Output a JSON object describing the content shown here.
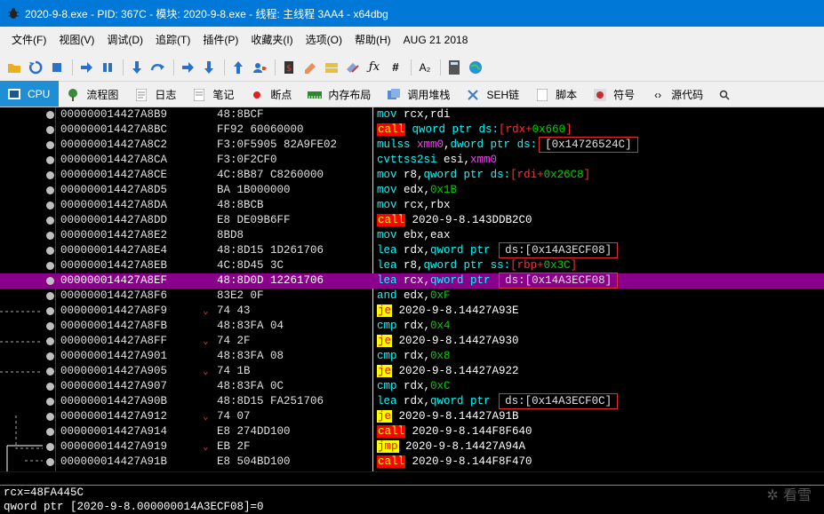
{
  "window": {
    "title": "2020-9-8.exe - PID: 367C - 模块: 2020-9-8.exe - 线程: 主线程 3AA4 - x64dbg",
    "icon": "bug-icon"
  },
  "menu": [
    "文件(F)",
    "视图(V)",
    "调试(D)",
    "追踪(T)",
    "插件(P)",
    "收藏夹(I)",
    "选项(O)",
    "帮助(H)",
    "AUG 21 2018"
  ],
  "toolbar_icons": [
    "open-icon",
    "restart-icon",
    "stop-icon",
    "run-icon",
    "pause-icon",
    "step-into-icon",
    "step-over-icon",
    "trace-into-icon",
    "trace-over-icon",
    "execute-till-return-icon",
    "run-to-user-code-icon",
    "patch-icon",
    "comment-icon",
    "label-icon",
    "bookmark-icon",
    "function-icon",
    "hash-icon",
    "font-icon",
    "calculator-icon",
    "globe-icon"
  ],
  "tabs": [
    {
      "label": "CPU",
      "icon": "cpu-icon",
      "active": true
    },
    {
      "label": "流程图",
      "icon": "graph-icon"
    },
    {
      "label": "日志",
      "icon": "log-icon"
    },
    {
      "label": "笔记",
      "icon": "notes-icon"
    },
    {
      "label": "断点",
      "icon": "breakpoint-icon"
    },
    {
      "label": "内存布局",
      "icon": "memory-icon"
    },
    {
      "label": "调用堆栈",
      "icon": "callstack-icon"
    },
    {
      "label": "SEH链",
      "icon": "seh-icon"
    },
    {
      "label": "脚本",
      "icon": "script-icon"
    },
    {
      "label": "符号",
      "icon": "symbols-icon"
    },
    {
      "label": "源代码",
      "icon": "source-icon"
    }
  ],
  "rows": [
    {
      "addr": "000000014427A8B9",
      "bytes": "48:8BCF",
      "jmark": "",
      "instr": [
        [
          "mov",
          "m-mnem"
        ],
        [
          " rcx",
          "m-white"
        ],
        [
          ",",
          "m-white"
        ],
        [
          "rdi",
          "m-white"
        ]
      ]
    },
    {
      "addr": "000000014427A8BC",
      "bytes": "FF92 60060000",
      "jmark": "",
      "instr": [
        [
          "call",
          "hl-call"
        ],
        [
          " qword ptr ",
          "m-mnem"
        ],
        [
          "ds:",
          "m-mnem"
        ],
        [
          "[",
          "m-red"
        ],
        [
          "rdx",
          "m-red"
        ],
        [
          "+",
          "m-red"
        ],
        [
          "0x660",
          "m-num"
        ],
        [
          "]",
          "m-red"
        ]
      ]
    },
    {
      "addr": "000000014427A8C2",
      "bytes": "F3:0F5905 82A9FE02",
      "jmark": "",
      "instr": [
        [
          "mulss",
          "m-mnem"
        ],
        [
          " xmm0",
          "m-mag"
        ],
        [
          ",",
          "m-white"
        ],
        [
          "dword ptr ",
          "m-mnem"
        ],
        [
          "ds:",
          "m-mnem"
        ],
        [
          "[0x14726524C]",
          "box"
        ]
      ]
    },
    {
      "addr": "000000014427A8CA",
      "bytes": "F3:0F2CF0",
      "jmark": "",
      "instr": [
        [
          "cvttss2si",
          "m-mnem"
        ],
        [
          " esi",
          "m-white"
        ],
        [
          ",",
          "m-white"
        ],
        [
          "xmm0",
          "m-mag"
        ]
      ]
    },
    {
      "addr": "000000014427A8CE",
      "bytes": "4C:8B87 C8260000",
      "jmark": "",
      "instr": [
        [
          "mov",
          "m-mnem"
        ],
        [
          " r8",
          "m-white"
        ],
        [
          ",",
          "m-white"
        ],
        [
          "qword ptr ",
          "m-mnem"
        ],
        [
          "ds:",
          "m-mnem"
        ],
        [
          "[",
          "m-red"
        ],
        [
          "rdi",
          "m-red"
        ],
        [
          "+",
          "m-red"
        ],
        [
          "0x26C8",
          "m-num"
        ],
        [
          "]",
          "m-red"
        ]
      ]
    },
    {
      "addr": "000000014427A8D5",
      "bytes": "BA 1B000000",
      "jmark": "",
      "instr": [
        [
          "mov",
          "m-mnem"
        ],
        [
          " edx",
          "m-white"
        ],
        [
          ",",
          "m-white"
        ],
        [
          "0x1B",
          "m-num"
        ]
      ]
    },
    {
      "addr": "000000014427A8DA",
      "bytes": "48:8BCB",
      "jmark": "",
      "instr": [
        [
          "mov",
          "m-mnem"
        ],
        [
          " rcx",
          "m-white"
        ],
        [
          ",",
          "m-white"
        ],
        [
          "rbx",
          "m-white"
        ]
      ]
    },
    {
      "addr": "000000014427A8DD",
      "bytes": "E8 DE09B6FF",
      "jmark": "",
      "instr": [
        [
          "call",
          "hl-call"
        ],
        [
          " 2020-9-8.143DDB2C0",
          "m-white"
        ]
      ]
    },
    {
      "addr": "000000014427A8E2",
      "bytes": "8BD8",
      "jmark": "",
      "instr": [
        [
          "mov",
          "m-mnem"
        ],
        [
          " ebx",
          "m-white"
        ],
        [
          ",",
          "m-white"
        ],
        [
          "eax",
          "m-white"
        ]
      ]
    },
    {
      "addr": "000000014427A8E4",
      "bytes": "48:8D15 1D261706",
      "jmark": "",
      "instr": [
        [
          "lea",
          "m-mnem"
        ],
        [
          " rdx",
          "m-white"
        ],
        [
          ",",
          "m-white"
        ],
        [
          "qword ptr ",
          "m-mnem"
        ],
        [
          "ds:[0x14A3ECF08]",
          "box"
        ]
      ]
    },
    {
      "addr": "000000014427A8EB",
      "bytes": "4C:8D45 3C",
      "jmark": "",
      "instr": [
        [
          "lea",
          "m-mnem"
        ],
        [
          " r8",
          "m-white"
        ],
        [
          ",",
          "m-white"
        ],
        [
          "qword ptr ",
          "m-mnem"
        ],
        [
          "ss:",
          "m-mnem"
        ],
        [
          "[",
          "m-red"
        ],
        [
          "rbp",
          "m-red"
        ],
        [
          "+",
          "m-red"
        ],
        [
          "0x3C",
          "m-num"
        ],
        [
          "]",
          "m-red"
        ]
      ]
    },
    {
      "addr": "000000014427A8EF",
      "bytes": "48:8D0D 12261706",
      "jmark": "",
      "sel": true,
      "instr": [
        [
          "lea",
          "m-mnem"
        ],
        [
          " rcx",
          "m-white"
        ],
        [
          ",",
          "m-white"
        ],
        [
          "qword ptr ",
          "m-mnem"
        ],
        [
          "ds:[0x14A3ECF08]",
          "box"
        ]
      ]
    },
    {
      "addr": "000000014427A8F6",
      "bytes": "83E2 0F",
      "jmark": "",
      "instr": [
        [
          "and",
          "m-mnem"
        ],
        [
          " edx",
          "m-white"
        ],
        [
          ",",
          "m-white"
        ],
        [
          "0xF",
          "m-num"
        ]
      ]
    },
    {
      "addr": "000000014427A8F9",
      "bytes": "74 43",
      "jmark": "⌄",
      "instr": [
        [
          "je",
          "hl-jmp"
        ],
        [
          " 2020-9-8.14427A93E",
          "m-white"
        ]
      ]
    },
    {
      "addr": "000000014427A8FB",
      "bytes": "48:83FA 04",
      "jmark": "",
      "instr": [
        [
          "cmp",
          "m-mnem"
        ],
        [
          " rdx",
          "m-white"
        ],
        [
          ",",
          "m-white"
        ],
        [
          "0x4",
          "m-num"
        ]
      ]
    },
    {
      "addr": "000000014427A8FF",
      "bytes": "74 2F",
      "jmark": "⌄",
      "instr": [
        [
          "je",
          "hl-jmp"
        ],
        [
          " 2020-9-8.14427A930",
          "m-white"
        ]
      ]
    },
    {
      "addr": "000000014427A901",
      "bytes": "48:83FA 08",
      "jmark": "",
      "instr": [
        [
          "cmp",
          "m-mnem"
        ],
        [
          " rdx",
          "m-white"
        ],
        [
          ",",
          "m-white"
        ],
        [
          "0x8",
          "m-num"
        ]
      ]
    },
    {
      "addr": "000000014427A905",
      "bytes": "74 1B",
      "jmark": "⌄",
      "instr": [
        [
          "je",
          "hl-jmp"
        ],
        [
          " 2020-9-8.14427A922",
          "m-white"
        ]
      ]
    },
    {
      "addr": "000000014427A907",
      "bytes": "48:83FA 0C",
      "jmark": "",
      "instr": [
        [
          "cmp",
          "m-mnem"
        ],
        [
          " rdx",
          "m-white"
        ],
        [
          ",",
          "m-white"
        ],
        [
          "0xC",
          "m-num"
        ]
      ]
    },
    {
      "addr": "000000014427A90B",
      "bytes": "48:8D15 FA251706",
      "jmark": "",
      "instr": [
        [
          "lea",
          "m-mnem"
        ],
        [
          " rdx",
          "m-white"
        ],
        [
          ",",
          "m-white"
        ],
        [
          "qword ptr ",
          "m-mnem"
        ],
        [
          "ds:[0x14A3ECF0C]",
          "box"
        ]
      ]
    },
    {
      "addr": "000000014427A912",
      "bytes": "74 07",
      "jmark": "⌄",
      "instr": [
        [
          "je",
          "hl-jmp"
        ],
        [
          " 2020-9-8.14427A91B",
          "m-white"
        ]
      ]
    },
    {
      "addr": "000000014427A914",
      "bytes": "E8 274DD100",
      "jmark": "",
      "instr": [
        [
          "call",
          "hl-call"
        ],
        [
          " 2020-9-8.144F8F640",
          "m-white"
        ]
      ]
    },
    {
      "addr": "000000014427A919",
      "bytes": "EB 2F",
      "jmark": "⌄",
      "instr": [
        [
          "jmp",
          "hl-jmp"
        ],
        [
          " 2020-9-8.14427A94A",
          "m-white"
        ]
      ]
    },
    {
      "addr": "000000014427A91B",
      "bytes": "E8 504BD100",
      "jmark": "",
      "instr": [
        [
          "call",
          "hl-call"
        ],
        [
          " 2020-9-8.144F8F470",
          "m-white"
        ]
      ]
    }
  ],
  "info": {
    "line1": "rcx=48FA445C",
    "line2": "qword ptr [2020-9-8.000000014A3ECF08]=0"
  }
}
